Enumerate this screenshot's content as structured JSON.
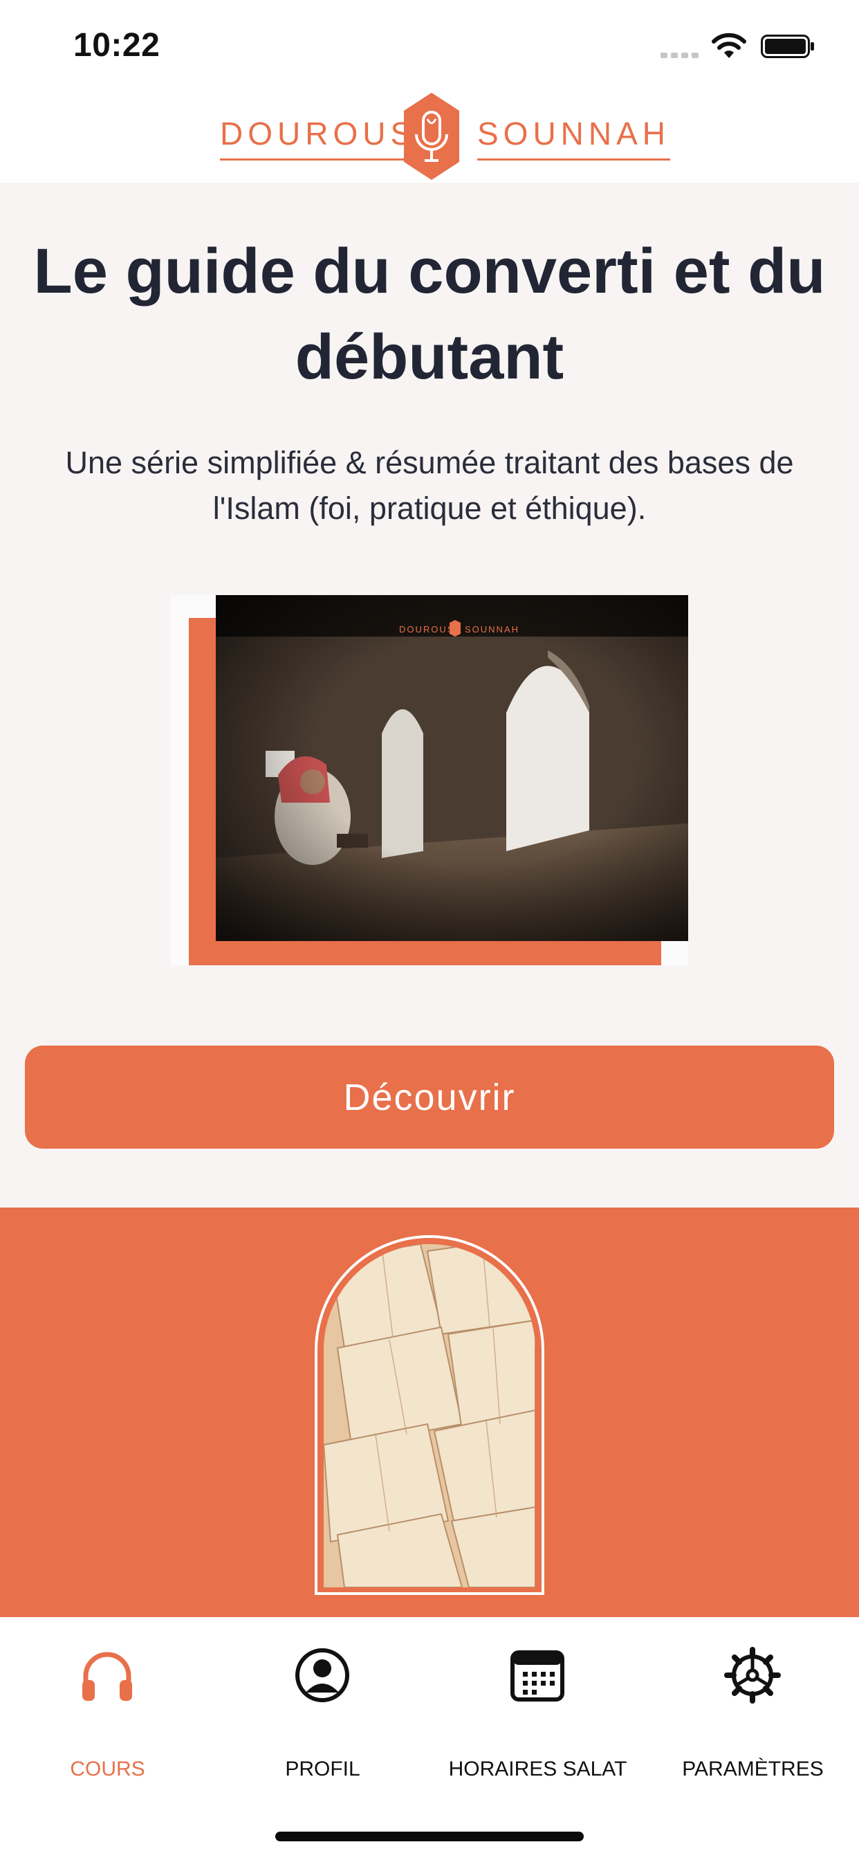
{
  "status_bar": {
    "time": "10:22"
  },
  "header": {
    "logo_left": "DOUROUS",
    "logo_right": "SOUNNAH"
  },
  "hero": {
    "title": "Le guide du converti et du débutant",
    "subtitle": "Une série simplifiée & résumée traitant des bases de l'Islam (foi, pratique et éthique).",
    "image_logo_left": "DOUROUS",
    "image_logo_right": "SOUNNAH",
    "button_label": "Découvrir"
  },
  "tabs": [
    {
      "label": "COURS",
      "icon": "headphones-icon",
      "active": true
    },
    {
      "label": "PROFIL",
      "icon": "profile-icon",
      "active": false
    },
    {
      "label": "HORAIRES SALAT",
      "icon": "calendar-icon",
      "active": false
    },
    {
      "label": "PARAMÈTRES",
      "icon": "gear-icon",
      "active": false
    }
  ],
  "colors": {
    "accent": "#e8704a",
    "hero_background": "#f7f4f3",
    "title_text": "#222634",
    "active_tab": "#e8704a"
  }
}
